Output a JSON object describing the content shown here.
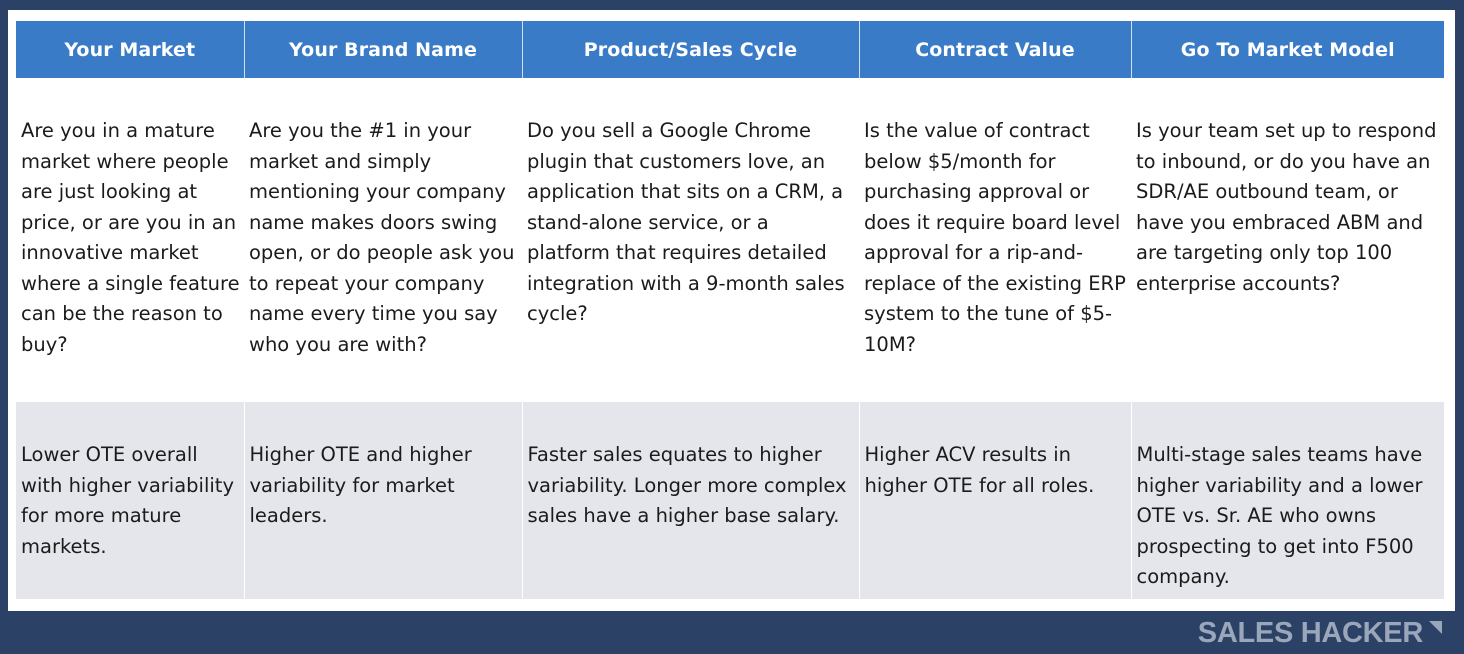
{
  "table": {
    "headers": [
      "Your Market",
      "Your Brand Name",
      "Product/Sales Cycle",
      "Contract Value",
      "Go To Market Model"
    ],
    "questions": [
      "Are you in a mature market where people are just looking at price, or are you in an innovative market where a single feature can be the reason to buy?",
      "Are you the #1 in your market and simply mentioning your company name makes doors swing open, or do people ask you to repeat your company name every time you say who you are with?",
      "Do you sell a Google Chrome plugin that customers love, an application that sits on a CRM, a stand-alone service, or a platform that requires detailed integration with a 9-month sales cycle?",
      "Is the value of contract below $5/month for purchasing approval or does it require board level approval for a rip-and-replace of the existing ERP system to the tune of $5-10M?",
      "Is your team set up to respond to inbound, or do you have an SDR/AE outbound team, or have you embraced ABM and are targeting only top 100 enterprise accounts?"
    ],
    "effects": [
      "Lower OTE overall with higher variability for more mature markets.",
      "Higher OTE and higher variability for market leaders.",
      "Faster sales equates to higher variability. Longer more complex sales have a higher base salary.",
      "Higher ACV results in higher OTE for all roles.",
      "Multi-stage sales teams have higher variability and a lower OTE vs. Sr. AE who owns prospecting to get into F500 company."
    ]
  },
  "brand": {
    "name": "SALES HACKER",
    "icon": "corner-triangle-icon"
  },
  "colors": {
    "background": "#2c4166",
    "header": "#3a7bc8",
    "effects_row": "#e5e6ec",
    "brand_text": "#9aa6b9"
  }
}
